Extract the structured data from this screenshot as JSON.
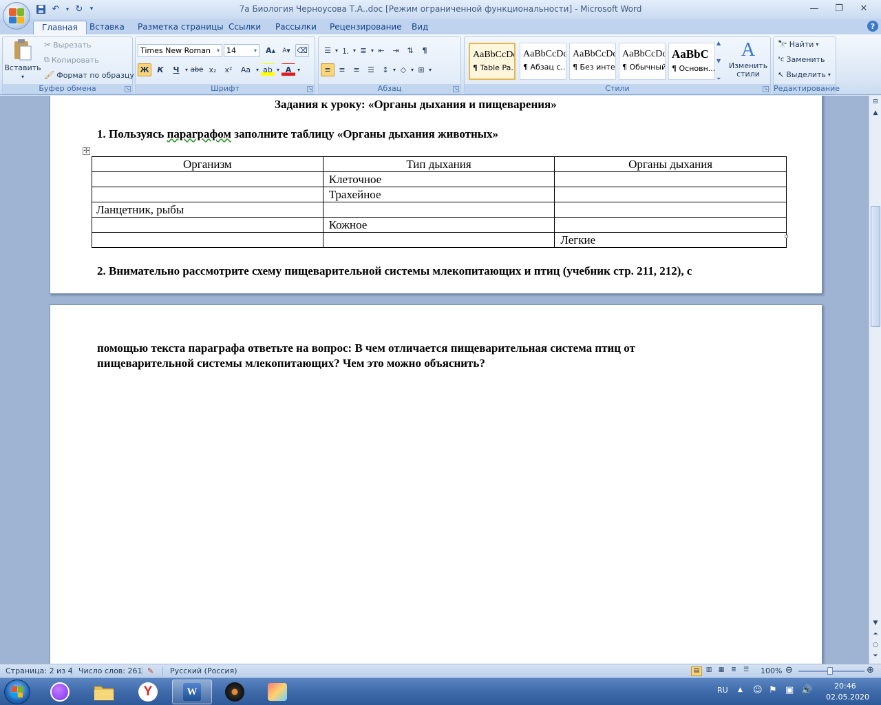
{
  "window": {
    "title": "7а Биология Черноусова Т.А..doc [Режим ограниченной функциональности] - Microsoft Word"
  },
  "tabs": [
    "Главная",
    "Вставка",
    "Разметка страницы",
    "Ссылки",
    "Рассылки",
    "Рецензирование",
    "Вид"
  ],
  "ribbon": {
    "clipboard": {
      "paste": "Вставить",
      "cut": "Вырезать",
      "copy": "Копировать",
      "format_painter": "Формат по образцу",
      "label": "Буфер обмена"
    },
    "font": {
      "name": "Times New Roman",
      "size": "14",
      "bold": "Ж",
      "italic": "К",
      "underline": "Ч",
      "strike": "abe",
      "subscript": "x₂",
      "superscript": "x²",
      "case": "Aa",
      "label": "Шрифт"
    },
    "paragraph": {
      "label": "Абзац"
    },
    "styles": {
      "items": [
        {
          "sample": "AaBbCcDd",
          "name": "¶ Table Pa..."
        },
        {
          "sample": "AaBbCcDd",
          "name": "¶ Абзац с..."
        },
        {
          "sample": "AaBbCcDd",
          "name": "¶ Без инте..."
        },
        {
          "sample": "AaBbCcDd",
          "name": "¶ Обычный"
        },
        {
          "sample": "AaBbC",
          "name": "¶ Основн..."
        }
      ],
      "change": "Изменить стили",
      "label": "Стили"
    },
    "editing": {
      "find": "Найти",
      "replace": "Заменить",
      "select": "Выделить",
      "label": "Редактирование"
    }
  },
  "document": {
    "page1": {
      "heading": "Задания к уроку: «Органы дыхания и пищеварения»",
      "task1_prefix": "1. Пользуясь ",
      "task1_underlined": "параграфом",
      "task1_suffix": " заполните таблицу «Органы дыхания животных»",
      "table": {
        "headers": [
          "Организм",
          "Тип дыхания",
          "Органы  дыхания"
        ],
        "rows": [
          [
            "",
            "Клеточное",
            ""
          ],
          [
            "",
            "Трахейное",
            ""
          ],
          [
            "Ланцетник, рыбы",
            "",
            ""
          ],
          [
            "",
            "Кожное",
            ""
          ],
          [
            "",
            "",
            "Легкие"
          ]
        ]
      },
      "task2_line1": "2. Внимательно рассмотрите схему пищеварительной системы млекопитающих и птиц (учебник стр. 211, 212), с"
    },
    "page2": {
      "line1": "помощью текста параграфа ответьте на вопрос: В чем отличается пищеварительная система птиц от",
      "line2": "пищеварительной системы млекопитающих?  Чем это можно объяснить?"
    }
  },
  "statusbar": {
    "page": "Страница: 2 из 4",
    "words": "Число слов: 261",
    "language": "Русский (Россия)",
    "zoom": "100%"
  },
  "taskbar": {
    "lang": "RU",
    "time": "20:46",
    "date": "02.05.2020"
  },
  "colors": {
    "accent": "#15428b",
    "ribbon_bg": "#dbe7f5",
    "doc_bg": "#9fb4d2",
    "taskbar": "#3f6bab"
  }
}
